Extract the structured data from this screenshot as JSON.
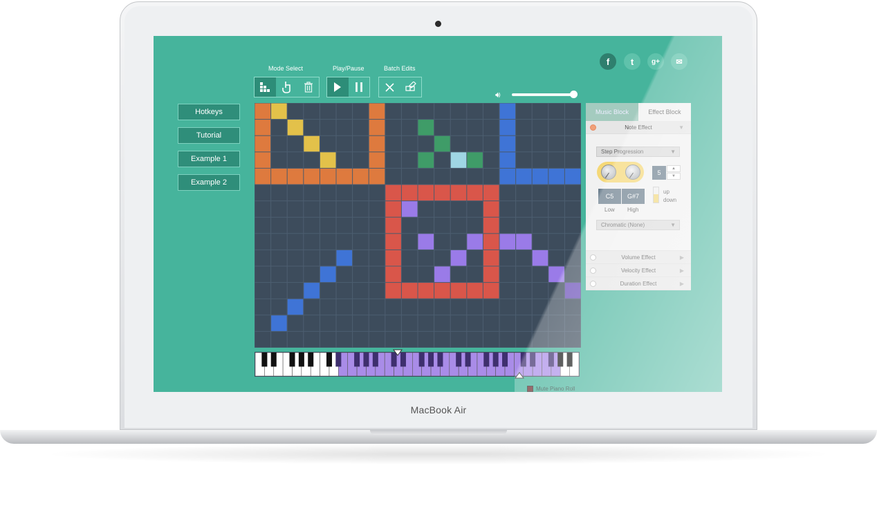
{
  "device": {
    "brand": "MacBook Air"
  },
  "social": [
    {
      "icon": "facebook-icon",
      "glyph": "f"
    },
    {
      "icon": "twitter-icon",
      "glyph": "t"
    },
    {
      "icon": "googleplus-icon",
      "glyph": "g+"
    },
    {
      "icon": "email-icon",
      "glyph": "✉"
    }
  ],
  "sidebar": {
    "items": [
      {
        "label": "Hotkeys"
      },
      {
        "label": "Tutorial"
      },
      {
        "label": "Example 1"
      },
      {
        "label": "Example 2"
      }
    ]
  },
  "toolbar": {
    "mode_select_label": "Mode Select",
    "play_pause_label": "Play/Pause",
    "batch_edits_label": "Batch Edits",
    "mode_tools": [
      {
        "icon": "block-mode-icon",
        "active": true
      },
      {
        "icon": "hand-pointer-icon",
        "active": false
      },
      {
        "icon": "trash-icon",
        "active": false
      }
    ],
    "play_tools": [
      {
        "icon": "play-icon",
        "active": true
      },
      {
        "icon": "pause-icon",
        "active": false
      }
    ],
    "batch_tools": [
      {
        "icon": "clear-icon",
        "active": false
      },
      {
        "icon": "edit-blocks-icon",
        "active": false
      }
    ]
  },
  "volume": {
    "icon": "speaker-icon",
    "level": 0.95
  },
  "grid": {
    "cols": 20,
    "rows": 15,
    "background": "#3d4c5c",
    "cells": [
      {
        "c": 0,
        "r": 0,
        "color": "#de7a3e"
      },
      {
        "c": 0,
        "r": 1,
        "color": "#de7a3e"
      },
      {
        "c": 0,
        "r": 2,
        "color": "#de7a3e"
      },
      {
        "c": 0,
        "r": 3,
        "color": "#de7a3e"
      },
      {
        "c": 0,
        "r": 4,
        "color": "#de7a3e"
      },
      {
        "c": 7,
        "r": 0,
        "color": "#de7a3e"
      },
      {
        "c": 7,
        "r": 1,
        "color": "#de7a3e"
      },
      {
        "c": 7,
        "r": 2,
        "color": "#de7a3e"
      },
      {
        "c": 7,
        "r": 3,
        "color": "#de7a3e"
      },
      {
        "c": 7,
        "r": 4,
        "color": "#de7a3e"
      },
      {
        "c": 0,
        "r": 4,
        "color": "#de7a3e"
      },
      {
        "c": 1,
        "r": 4,
        "color": "#de7a3e"
      },
      {
        "c": 2,
        "r": 4,
        "color": "#de7a3e"
      },
      {
        "c": 3,
        "r": 4,
        "color": "#de7a3e"
      },
      {
        "c": 4,
        "r": 4,
        "color": "#de7a3e"
      },
      {
        "c": 5,
        "r": 4,
        "color": "#de7a3e"
      },
      {
        "c": 6,
        "r": 4,
        "color": "#de7a3e"
      },
      {
        "c": 1,
        "r": 0,
        "color": "#e3c14a"
      },
      {
        "c": 2,
        "r": 1,
        "color": "#e3c14a"
      },
      {
        "c": 3,
        "r": 2,
        "color": "#e3c14a"
      },
      {
        "c": 4,
        "r": 3,
        "color": "#e3c14a"
      },
      {
        "c": 10,
        "r": 1,
        "color": "#3f9c68"
      },
      {
        "c": 11,
        "r": 2,
        "color": "#3f9c68"
      },
      {
        "c": 10,
        "r": 3,
        "color": "#3f9c68"
      },
      {
        "c": 13,
        "r": 3,
        "color": "#3f9c68"
      },
      {
        "c": 12,
        "r": 3,
        "color": "#9fd6e4"
      },
      {
        "c": 15,
        "r": 0,
        "color": "#3f74d6"
      },
      {
        "c": 15,
        "r": 1,
        "color": "#3f74d6"
      },
      {
        "c": 15,
        "r": 2,
        "color": "#3f74d6"
      },
      {
        "c": 15,
        "r": 3,
        "color": "#3f74d6"
      },
      {
        "c": 15,
        "r": 4,
        "color": "#3f74d6"
      },
      {
        "c": 16,
        "r": 4,
        "color": "#3f74d6"
      },
      {
        "c": 17,
        "r": 4,
        "color": "#3f74d6"
      },
      {
        "c": 18,
        "r": 4,
        "color": "#3f74d6"
      },
      {
        "c": 19,
        "r": 4,
        "color": "#3f74d6"
      },
      {
        "c": 8,
        "r": 5,
        "color": "#d9564a"
      },
      {
        "c": 9,
        "r": 5,
        "color": "#d9564a"
      },
      {
        "c": 10,
        "r": 5,
        "color": "#d9564a"
      },
      {
        "c": 11,
        "r": 5,
        "color": "#d9564a"
      },
      {
        "c": 12,
        "r": 5,
        "color": "#d9564a"
      },
      {
        "c": 13,
        "r": 5,
        "color": "#d9564a"
      },
      {
        "c": 14,
        "r": 5,
        "color": "#d9564a"
      },
      {
        "c": 8,
        "r": 6,
        "color": "#d9564a"
      },
      {
        "c": 8,
        "r": 7,
        "color": "#d9564a"
      },
      {
        "c": 8,
        "r": 8,
        "color": "#d9564a"
      },
      {
        "c": 8,
        "r": 9,
        "color": "#d9564a"
      },
      {
        "c": 8,
        "r": 10,
        "color": "#d9564a"
      },
      {
        "c": 8,
        "r": 11,
        "color": "#d9564a"
      },
      {
        "c": 14,
        "r": 6,
        "color": "#d9564a"
      },
      {
        "c": 14,
        "r": 7,
        "color": "#d9564a"
      },
      {
        "c": 14,
        "r": 8,
        "color": "#d9564a"
      },
      {
        "c": 14,
        "r": 9,
        "color": "#d9564a"
      },
      {
        "c": 14,
        "r": 10,
        "color": "#d9564a"
      },
      {
        "c": 14,
        "r": 11,
        "color": "#d9564a"
      },
      {
        "c": 9,
        "r": 11,
        "color": "#d9564a"
      },
      {
        "c": 10,
        "r": 11,
        "color": "#d9564a"
      },
      {
        "c": 11,
        "r": 11,
        "color": "#d9564a"
      },
      {
        "c": 12,
        "r": 11,
        "color": "#d9564a"
      },
      {
        "c": 13,
        "r": 11,
        "color": "#d9564a"
      },
      {
        "c": 9,
        "r": 6,
        "color": "#9a7be8"
      },
      {
        "c": 10,
        "r": 8,
        "color": "#9a7be8"
      },
      {
        "c": 13,
        "r": 8,
        "color": "#9a7be8"
      },
      {
        "c": 12,
        "r": 9,
        "color": "#9a7be8"
      },
      {
        "c": 11,
        "r": 10,
        "color": "#9a7be8"
      },
      {
        "c": 15,
        "r": 8,
        "color": "#9a7be8"
      },
      {
        "c": 16,
        "r": 8,
        "color": "#9a7be8"
      },
      {
        "c": 17,
        "r": 9,
        "color": "#9a7be8"
      },
      {
        "c": 18,
        "r": 10,
        "color": "#9a7be8"
      },
      {
        "c": 19,
        "r": 11,
        "color": "#6a4fb8"
      },
      {
        "c": 5,
        "r": 9,
        "color": "#3f74d6"
      },
      {
        "c": 4,
        "r": 10,
        "color": "#3f74d6"
      },
      {
        "c": 3,
        "r": 11,
        "color": "#3f74d6"
      },
      {
        "c": 2,
        "r": 12,
        "color": "#3f74d6"
      },
      {
        "c": 1,
        "r": 13,
        "color": "#3f74d6"
      }
    ]
  },
  "piano": {
    "white_keys": 35,
    "range_start_key": 9,
    "range_end_key": 16,
    "range_color": "#a98ce8"
  },
  "mute": {
    "label": "Mute Piano Roll"
  },
  "panel": {
    "tabs": [
      {
        "label": "Music Block",
        "active": false
      },
      {
        "label": "Effect Block",
        "active": true
      }
    ],
    "note_effect": {
      "label": "Note Effect",
      "enabled": true
    },
    "step_progression": "Step Progression",
    "low_note": "C5",
    "high_note": "G#7",
    "low_label": "Low",
    "high_label": "High",
    "step_value": "5",
    "up_label": "up",
    "down_label": "down",
    "scale": "Chromatic (None)",
    "effects": [
      {
        "label": "Volume Effect"
      },
      {
        "label": "Velocity Effect"
      },
      {
        "label": "Duration Effect"
      }
    ]
  }
}
